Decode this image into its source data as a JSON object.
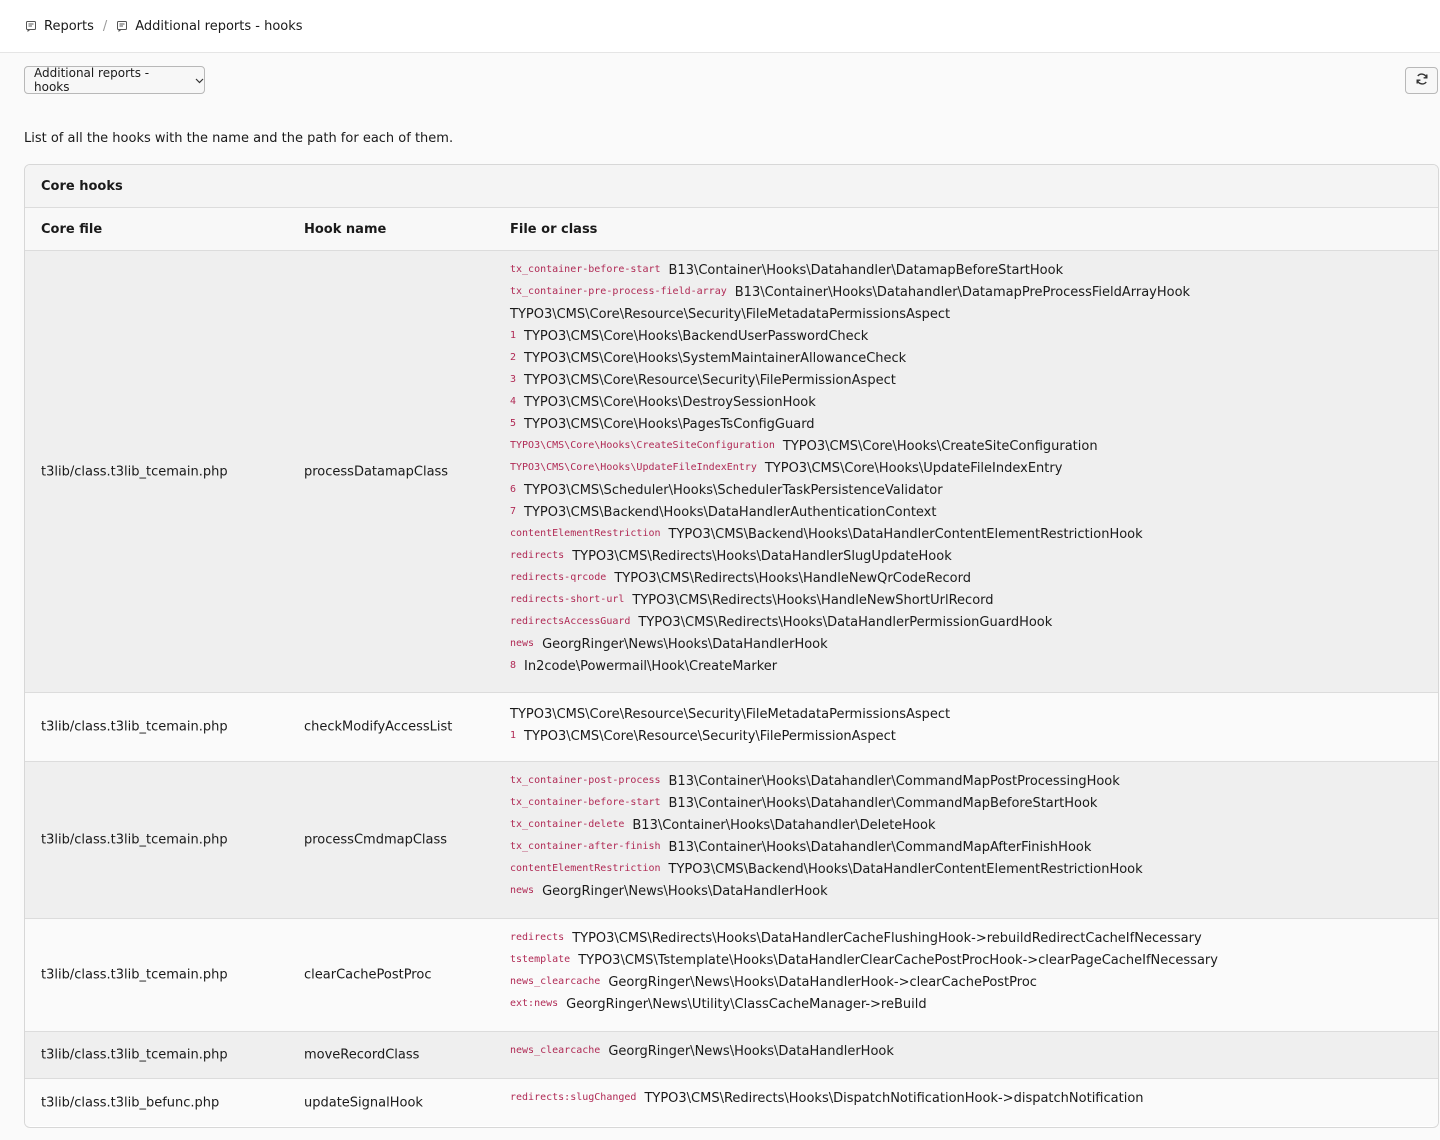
{
  "breadcrumb": {
    "items": [
      {
        "label": "Reports",
        "icon": "report-icon"
      },
      {
        "label": "Additional reports - hooks",
        "icon": "report-icon"
      }
    ],
    "separator": "/"
  },
  "toolbar": {
    "dropdown_value": "Additional reports - hooks",
    "refresh_icon": "refresh-icon"
  },
  "intro": "List of all the hooks with the name and the path for each of them.",
  "panel": {
    "title": "Core hooks",
    "columns": [
      "Core file",
      "Hook name",
      "File or class"
    ],
    "rows": [
      {
        "core_file": "t3lib/class.t3lib_tcemain.php",
        "hook_name": "processDatamapClass",
        "hooks": [
          {
            "key": "tx_container-before-start",
            "value": "B13\\Container\\Hooks\\Datahandler\\DatamapBeforeStartHook"
          },
          {
            "key": "tx_container-pre-process-field-array",
            "value": "B13\\Container\\Hooks\\Datahandler\\DatamapPreProcessFieldArrayHook"
          },
          {
            "key": "",
            "value": "TYPO3\\CMS\\Core\\Resource\\Security\\FileMetadataPermissionsAspect"
          },
          {
            "key": "1",
            "value": "TYPO3\\CMS\\Core\\Hooks\\BackendUserPasswordCheck"
          },
          {
            "key": "2",
            "value": "TYPO3\\CMS\\Core\\Hooks\\SystemMaintainerAllowanceCheck"
          },
          {
            "key": "3",
            "value": "TYPO3\\CMS\\Core\\Resource\\Security\\FilePermissionAspect"
          },
          {
            "key": "4",
            "value": "TYPO3\\CMS\\Core\\Hooks\\DestroySessionHook"
          },
          {
            "key": "5",
            "value": "TYPO3\\CMS\\Core\\Hooks\\PagesTsConfigGuard"
          },
          {
            "key": "TYPO3\\CMS\\Core\\Hooks\\CreateSiteConfiguration",
            "value": "TYPO3\\CMS\\Core\\Hooks\\CreateSiteConfiguration"
          },
          {
            "key": "TYPO3\\CMS\\Core\\Hooks\\UpdateFileIndexEntry",
            "value": "TYPO3\\CMS\\Core\\Hooks\\UpdateFileIndexEntry"
          },
          {
            "key": "6",
            "value": "TYPO3\\CMS\\Scheduler\\Hooks\\SchedulerTaskPersistenceValidator"
          },
          {
            "key": "7",
            "value": "TYPO3\\CMS\\Backend\\Hooks\\DataHandlerAuthenticationContext"
          },
          {
            "key": "contentElementRestriction",
            "value": "TYPO3\\CMS\\Backend\\Hooks\\DataHandlerContentElementRestrictionHook"
          },
          {
            "key": "redirects",
            "value": "TYPO3\\CMS\\Redirects\\Hooks\\DataHandlerSlugUpdateHook"
          },
          {
            "key": "redirects-qrcode",
            "value": "TYPO3\\CMS\\Redirects\\Hooks\\HandleNewQrCodeRecord"
          },
          {
            "key": "redirects-short-url",
            "value": "TYPO3\\CMS\\Redirects\\Hooks\\HandleNewShortUrlRecord"
          },
          {
            "key": "redirectsAccessGuard",
            "value": "TYPO3\\CMS\\Redirects\\Hooks\\DataHandlerPermissionGuardHook"
          },
          {
            "key": "news",
            "value": "GeorgRinger\\News\\Hooks\\DataHandlerHook"
          },
          {
            "key": "8",
            "value": "In2code\\Powermail\\Hook\\CreateMarker"
          }
        ]
      },
      {
        "core_file": "t3lib/class.t3lib_tcemain.php",
        "hook_name": "checkModifyAccessList",
        "hooks": [
          {
            "key": "",
            "value": "TYPO3\\CMS\\Core\\Resource\\Security\\FileMetadataPermissionsAspect"
          },
          {
            "key": "1",
            "value": "TYPO3\\CMS\\Core\\Resource\\Security\\FilePermissionAspect"
          }
        ]
      },
      {
        "core_file": "t3lib/class.t3lib_tcemain.php",
        "hook_name": "processCmdmapClass",
        "hooks": [
          {
            "key": "tx_container-post-process",
            "value": "B13\\Container\\Hooks\\Datahandler\\CommandMapPostProcessingHook"
          },
          {
            "key": "tx_container-before-start",
            "value": "B13\\Container\\Hooks\\Datahandler\\CommandMapBeforeStartHook"
          },
          {
            "key": "tx_container-delete",
            "value": "B13\\Container\\Hooks\\Datahandler\\DeleteHook"
          },
          {
            "key": "tx_container-after-finish",
            "value": "B13\\Container\\Hooks\\Datahandler\\CommandMapAfterFinishHook"
          },
          {
            "key": "contentElementRestriction",
            "value": "TYPO3\\CMS\\Backend\\Hooks\\DataHandlerContentElementRestrictionHook"
          },
          {
            "key": "news",
            "value": "GeorgRinger\\News\\Hooks\\DataHandlerHook"
          }
        ]
      },
      {
        "core_file": "t3lib/class.t3lib_tcemain.php",
        "hook_name": "clearCachePostProc",
        "hooks": [
          {
            "key": "redirects",
            "value": "TYPO3\\CMS\\Redirects\\Hooks\\DataHandlerCacheFlushingHook->rebuildRedirectCacheIfNecessary"
          },
          {
            "key": "tstemplate",
            "value": "TYPO3\\CMS\\Tstemplate\\Hooks\\DataHandlerClearCachePostProcHook->clearPageCacheIfNecessary"
          },
          {
            "key": "news_clearcache",
            "value": "GeorgRinger\\News\\Hooks\\DataHandlerHook->clearCachePostProc"
          },
          {
            "key": "ext:news",
            "value": "GeorgRinger\\News\\Utility\\ClassCacheManager->reBuild"
          }
        ]
      },
      {
        "core_file": "t3lib/class.t3lib_tcemain.php",
        "hook_name": "moveRecordClass",
        "hooks": [
          {
            "key": "news_clearcache",
            "value": "GeorgRinger\\News\\Hooks\\DataHandlerHook"
          }
        ]
      },
      {
        "core_file": "t3lib/class.t3lib_befunc.php",
        "hook_name": "updateSignalHook",
        "hooks": [
          {
            "key": "redirects:slugChanged",
            "value": "TYPO3\\CMS\\Redirects\\Hooks\\DispatchNotificationHook->dispatchNotification"
          }
        ]
      }
    ]
  }
}
